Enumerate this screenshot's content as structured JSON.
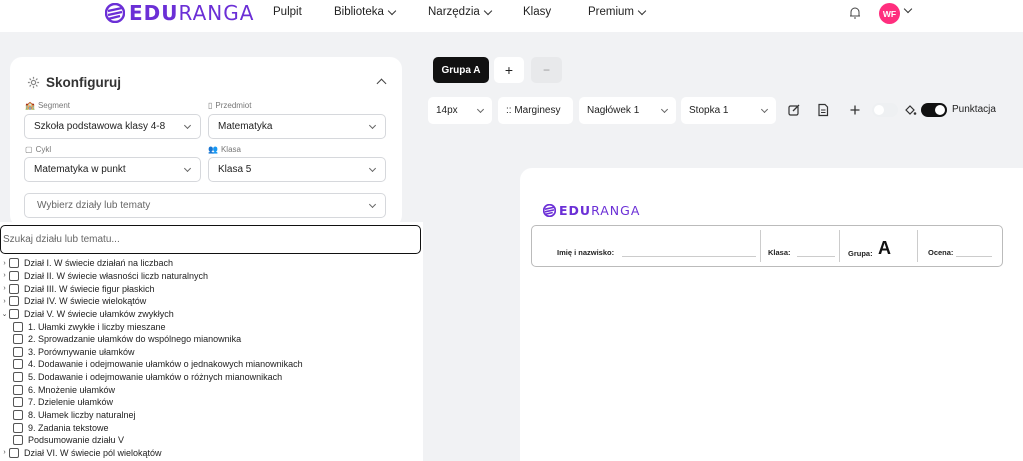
{
  "brand": {
    "name_bold": "EDU",
    "name_thin": "RANGA",
    "color": "#6b2fd6"
  },
  "nav": {
    "items": [
      {
        "label": "Pulpit",
        "has_dropdown": false
      },
      {
        "label": "Biblioteka",
        "has_dropdown": true
      },
      {
        "label": "Narzędzia",
        "has_dropdown": true
      },
      {
        "label": "Klasy",
        "has_dropdown": false
      },
      {
        "label": "Premium",
        "has_dropdown": true
      }
    ],
    "avatar_initials": "WF",
    "avatar_color": "#ff2e7e"
  },
  "config": {
    "title": "Skonfiguruj",
    "segment": {
      "label": "Segment",
      "value": "Szkoła podstawowa klasy 4-8"
    },
    "subject": {
      "label": "Przedmiot",
      "value": "Matematyka"
    },
    "cycle": {
      "label": "Cykl",
      "value": "Matematyka w punkt"
    },
    "class": {
      "label": "Klasa",
      "value": "Klasa 5"
    },
    "topics": {
      "placeholder": "Wybierz działy lub tematy"
    },
    "search": {
      "placeholder": "Szukaj działu lub tematu..."
    },
    "tree": [
      {
        "label": "Dział I. W świecie działań na liczbach",
        "arrow": "›",
        "child": false
      },
      {
        "label": "Dział II. W świecie własności liczb naturalnych",
        "arrow": "›",
        "child": false
      },
      {
        "label": "Dział III. W świecie figur płaskich",
        "arrow": "›",
        "child": false
      },
      {
        "label": "Dział IV. W świecie wielokątów",
        "arrow": "›",
        "child": false
      },
      {
        "label": "Dział V. W świecie ułamków zwykłych",
        "arrow": "⌄",
        "child": false
      },
      {
        "label": "1. Ułamki zwykłe i liczby mieszane",
        "child": true
      },
      {
        "label": "2. Sprowadzanie ułamków do wspólnego mianownika",
        "child": true
      },
      {
        "label": "3. Porównywanie ułamków",
        "child": true
      },
      {
        "label": "4. Dodawanie i odejmowanie ułamków o jednakowych mianownikach",
        "child": true
      },
      {
        "label": "5. Dodawanie i odejmowanie ułamków o różnych mianownikach",
        "child": true
      },
      {
        "label": "6. Mnożenie ułamków",
        "child": true
      },
      {
        "label": "7. Dzielenie ułamków",
        "child": true
      },
      {
        "label": "8. Ułamek liczby naturalnej",
        "child": true
      },
      {
        "label": "9. Zadania tekstowe",
        "child": true
      },
      {
        "label": "Podsumowanie działu V",
        "child": true
      },
      {
        "label": "Dział VI. W świecie pól wielokątów",
        "arrow": "›",
        "child": false
      }
    ]
  },
  "groups": {
    "active": "Grupa A",
    "add": "+",
    "remove": "−"
  },
  "toolbar": {
    "font_size": "14px",
    "margins": ":: Marginesy",
    "header": "Nagłówek 1",
    "footer": "Stopka 1",
    "punctuation_label": "Punktacja"
  },
  "worksheet": {
    "name_label": "Imię i nazwisko:",
    "class_label": "Klasa:",
    "group_label": "Grupa:",
    "group_letter": "A",
    "grade_label": "Ocena:"
  }
}
